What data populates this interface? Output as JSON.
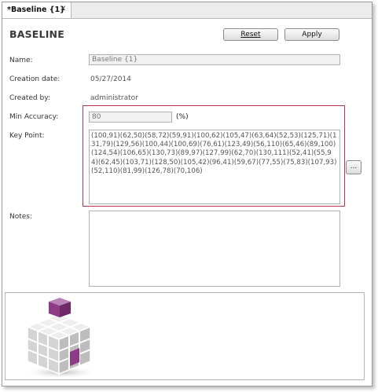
{
  "tab": {
    "title": "*Baseline {1}"
  },
  "header": {
    "title": "BASELINE"
  },
  "toolbar": {
    "reset_label": "Reset",
    "apply_label": "Apply"
  },
  "form": {
    "name_label": "Name:",
    "name_value": "Baseline {1}",
    "creation_date_label": "Creation date:",
    "creation_date_value": "05/27/2014",
    "created_by_label": "Created by:",
    "created_by_value": "administrator",
    "min_accuracy_label": "Min Accuracy:",
    "min_accuracy_value": "80",
    "min_accuracy_unit": "(%)",
    "key_point_label": "Key Point:",
    "key_point_value": "(100,91)(62,50)(58,72)(59,91)(100,62)(105,47)(63,64)(52,53)(125,71)(131,79)(129,56)(100,44)(100,69)(76,61)(123,49)(56,110)(65,46)(89,100)(124,54)(106,65)(130,73)(89,97)(127,99)(62,70)(130,111)(52,41)(55,94)(62,45)(103,71)(128,50)(105,42)(96,41)(59,67)(77,55)(75,83)(107,93)(52,110)(81,99)(126,78)(70,106)",
    "key_point_button": "...",
    "notes_label": "Notes:",
    "notes_value": ""
  },
  "colors": {
    "highlight_frame": "#c2334a",
    "logo_accent": "#8e3a86",
    "logo_cube": "#d9d9d9"
  },
  "icons": {
    "tab_close": "close-icon",
    "logo": "cube-logo-icon"
  }
}
